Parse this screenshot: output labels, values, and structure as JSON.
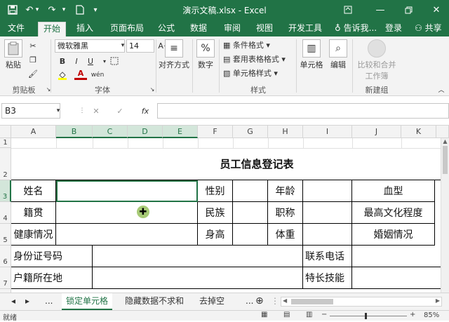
{
  "titlebar": {
    "title": "演示文稿.xlsx - Excel",
    "save_icon": "save-icon",
    "undo_icon": "undo-icon",
    "redo_icon": "redo-icon",
    "new_icon": "new-file-icon",
    "qat_dropdown": "▾"
  },
  "tabs": [
    "文件",
    "开始",
    "插入",
    "页面布局",
    "公式",
    "数据",
    "审阅",
    "视图",
    "开发工具"
  ],
  "tell_me": "告诉我...",
  "login": "登录",
  "share": "共享",
  "ribbon": {
    "paste": "粘贴",
    "clipboard_label": "剪贴板",
    "font_name": "微软雅黑",
    "font_size": "14",
    "font_label": "字体",
    "bold": "B",
    "italic": "I",
    "underline": "U",
    "font_color_glyph": "A",
    "phonetic": "wén",
    "align": "对齐方式",
    "number": "数字",
    "number_glyph": "%",
    "cond_format": "条件格式",
    "table_format": "套用表格格式",
    "cell_style": "单元格样式",
    "styles_label": "样式",
    "cells": "单元格",
    "editing": "编辑",
    "compare_merge_1": "比较和合并",
    "compare_merge_2": "工作簿",
    "new_group_label": "新建组"
  },
  "formula_bar": {
    "name_box": "B3",
    "cancel": "✕",
    "enter": "✓",
    "fx": "fx",
    "value": ""
  },
  "columns": [
    "A",
    "B",
    "C",
    "D",
    "E",
    "F",
    "G",
    "H",
    "I",
    "J",
    "K"
  ],
  "rows": [
    "1",
    "2",
    "3",
    "4",
    "5",
    "6",
    "7"
  ],
  "sheet": {
    "title": "员工信息登记表",
    "name": "姓名",
    "gender": "性别",
    "age": "年龄",
    "blood": "血型",
    "native": "籍贯",
    "ethnic": "民族",
    "position": "职称",
    "education": "最高文化程度",
    "health": "健康情况",
    "height": "身高",
    "weight": "体重",
    "marriage": "婚姻情况",
    "id_number": "身份证号码",
    "phone": "联系电话",
    "hukou": "户籍所在地",
    "skills": "特长技能"
  },
  "sheet_tabs": [
    "锁定单元格",
    "隐藏数据不求和",
    "去掉空"
  ],
  "sheet_nav_more": "...",
  "status": {
    "ready": "就绪",
    "zoom": "85%"
  },
  "colors": {
    "excel_green": "#217346",
    "ribbon_bg": "#f3f3f3",
    "sel_header": "#d3e6da"
  }
}
